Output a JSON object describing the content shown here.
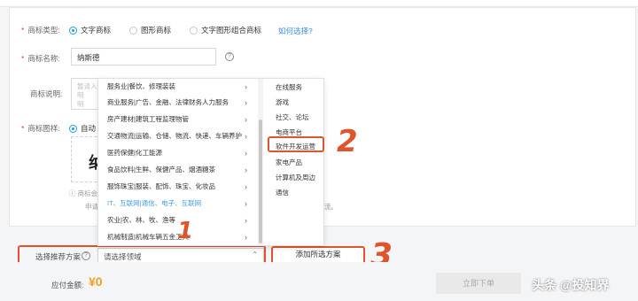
{
  "form": {
    "type_label": "商标类型:",
    "type_options": [
      "文字商标",
      "图形商标",
      "文字图形组合商标"
    ],
    "type_help_link": "如何选择?",
    "name_label": "商标名称:",
    "name_value": "纳斯德",
    "desc_label": "商标说明:",
    "desc_placeholder_1": "暂请入",
    "desc_placeholder_2": "明",
    "desc_placeholder_3": "明",
    "image_label": "商标图样:",
    "image_option": "自动",
    "preview_text": "纳",
    "hint_1": "ⓘ 商标会",
    "hint_2": "申请商",
    "hint_3": "流。"
  },
  "dropdown": {
    "categories": [
      "服务业|餐饮、修理装装",
      "商业服务|广告、金融、法律财务人力服务",
      "房产建材|建筑工程监理物管",
      "交通物流|运输、仓储、物流、快递、车辆养护",
      "医药保健|化工能源",
      "食品饮料|生鲜、保健产品、烟酒糖茶",
      "服饰珠宝|服装、配饰、珠宝、化妆品",
      "IT、互联网|通信、电子、互联网",
      "农业|农、林、牧、渔等",
      "机械制造|机械车辆五金工具"
    ],
    "active_index": 7,
    "subcategories": [
      "在线服务",
      "游戏",
      "社交、论坛",
      "电商平台",
      "软件开发运营",
      "家电产品",
      "计算机及周边",
      "通信"
    ]
  },
  "recommend": {
    "label": "选择推荐方案",
    "select_placeholder": "请选择领域",
    "add_button": "添加所选方案"
  },
  "footer": {
    "pay_label": "应付金额:",
    "pay_amount": "¥0",
    "submit_label": "立即下单"
  },
  "annotations": {
    "one": "1",
    "two": "2",
    "three": "3"
  },
  "watermark": {
    "text": "头条 @投知界"
  },
  "colors": {
    "accent": "#1aa0e8",
    "link": "#3e8ee8",
    "annotation": "#e0542c",
    "price": "#f0a020"
  }
}
